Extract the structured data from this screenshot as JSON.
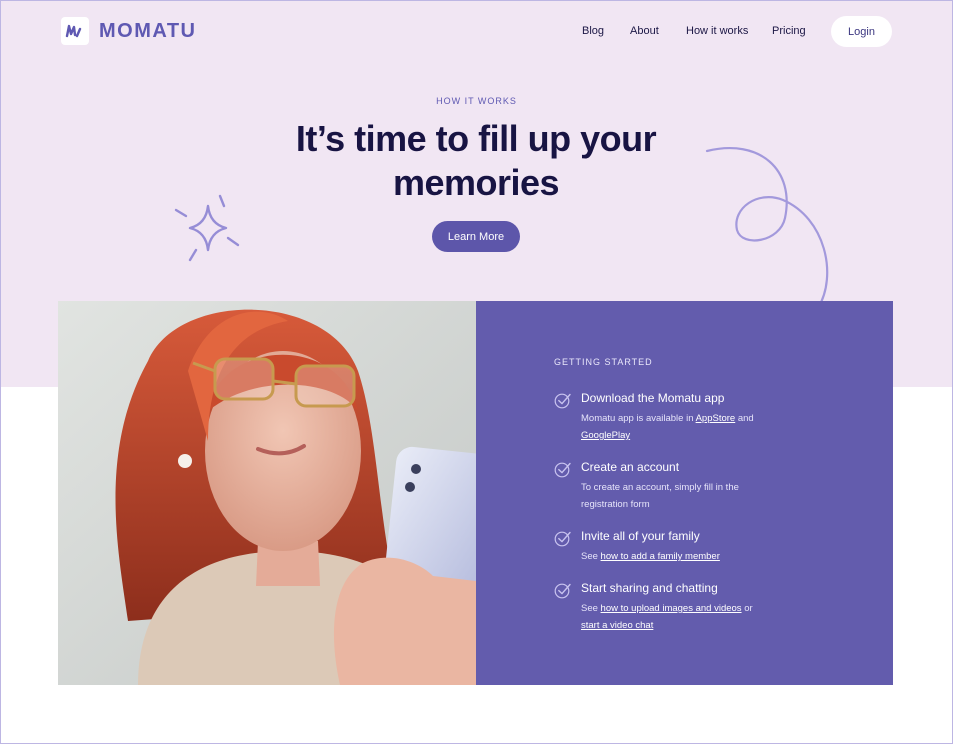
{
  "brand": {
    "name": "MOMATU"
  },
  "nav": {
    "items": [
      "Blog",
      "About",
      "How it works",
      "Pricing"
    ],
    "login": "Login"
  },
  "hero": {
    "eyebrow": "HOW IT WORKS",
    "title": "It’s time to fill up your memories",
    "cta": "Learn More"
  },
  "steps_section": {
    "eyebrow": "GETTING STARTED",
    "steps": [
      {
        "title": "Download the Momatu app",
        "desc_parts": [
          {
            "text": "Momatu app is available in "
          },
          {
            "text": "AppStore",
            "link": true
          },
          {
            "text": " and "
          },
          {
            "text": "GooglePlay",
            "link": true
          }
        ]
      },
      {
        "title": "Create an account",
        "desc_parts": [
          {
            "text": "To create an account, simply fill in the registration form"
          }
        ]
      },
      {
        "title": "Invite all of your family",
        "desc_parts": [
          {
            "text": "See "
          },
          {
            "text": "how to add a family member",
            "link": true
          }
        ]
      },
      {
        "title": "Start sharing and chatting",
        "desc_parts": [
          {
            "text": "See "
          },
          {
            "text": "how to upload images and videos",
            "link": true
          },
          {
            "text": " or "
          },
          {
            "text": "start a video chat",
            "link": true
          }
        ]
      }
    ]
  },
  "colors": {
    "brand": "#5f59b2",
    "hero_bg": "#f1e6f3",
    "panel_bg": "#635cad",
    "heading": "#181443",
    "cta_bg": "#5d56aa"
  },
  "icons": [
    "logo-mark-icon",
    "sparkle-icon",
    "swirl-arrow-icon",
    "check-icon"
  ]
}
